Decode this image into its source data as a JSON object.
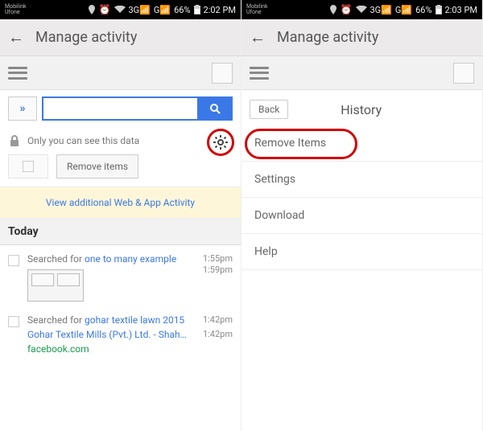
{
  "status": {
    "carrier_line1": "Mobilink",
    "carrier_line2": "Ufone",
    "signal_3g_a": "3G",
    "signal_3g_b": "G",
    "battery": "66%",
    "time_left": "2:02 PM",
    "time_right": "2:03 PM"
  },
  "header": {
    "title": "Manage activity"
  },
  "search": {
    "placeholder": ""
  },
  "privacy_text": "Only you can see this data",
  "remove_items_label": "Remove items",
  "wa_banner": "View additional Web & App Activity",
  "today_label": "Today",
  "history": [
    {
      "prefix": "Searched for ",
      "link": "one to many example",
      "time": "1:55pm",
      "thumb_time": "1:59pm"
    },
    {
      "prefix": "Searched for ",
      "link": "gohar textile lawn 2015",
      "time": "1:42pm",
      "sub1": "Gohar Textile Mills (Pvt.) Ltd. - Shah…",
      "sub1_time": "1:42pm",
      "sub2": "facebook.com"
    }
  ],
  "menu": {
    "back": "Back",
    "title": "History",
    "items": [
      "Remove Items",
      "Settings",
      "Download",
      "Help"
    ]
  }
}
